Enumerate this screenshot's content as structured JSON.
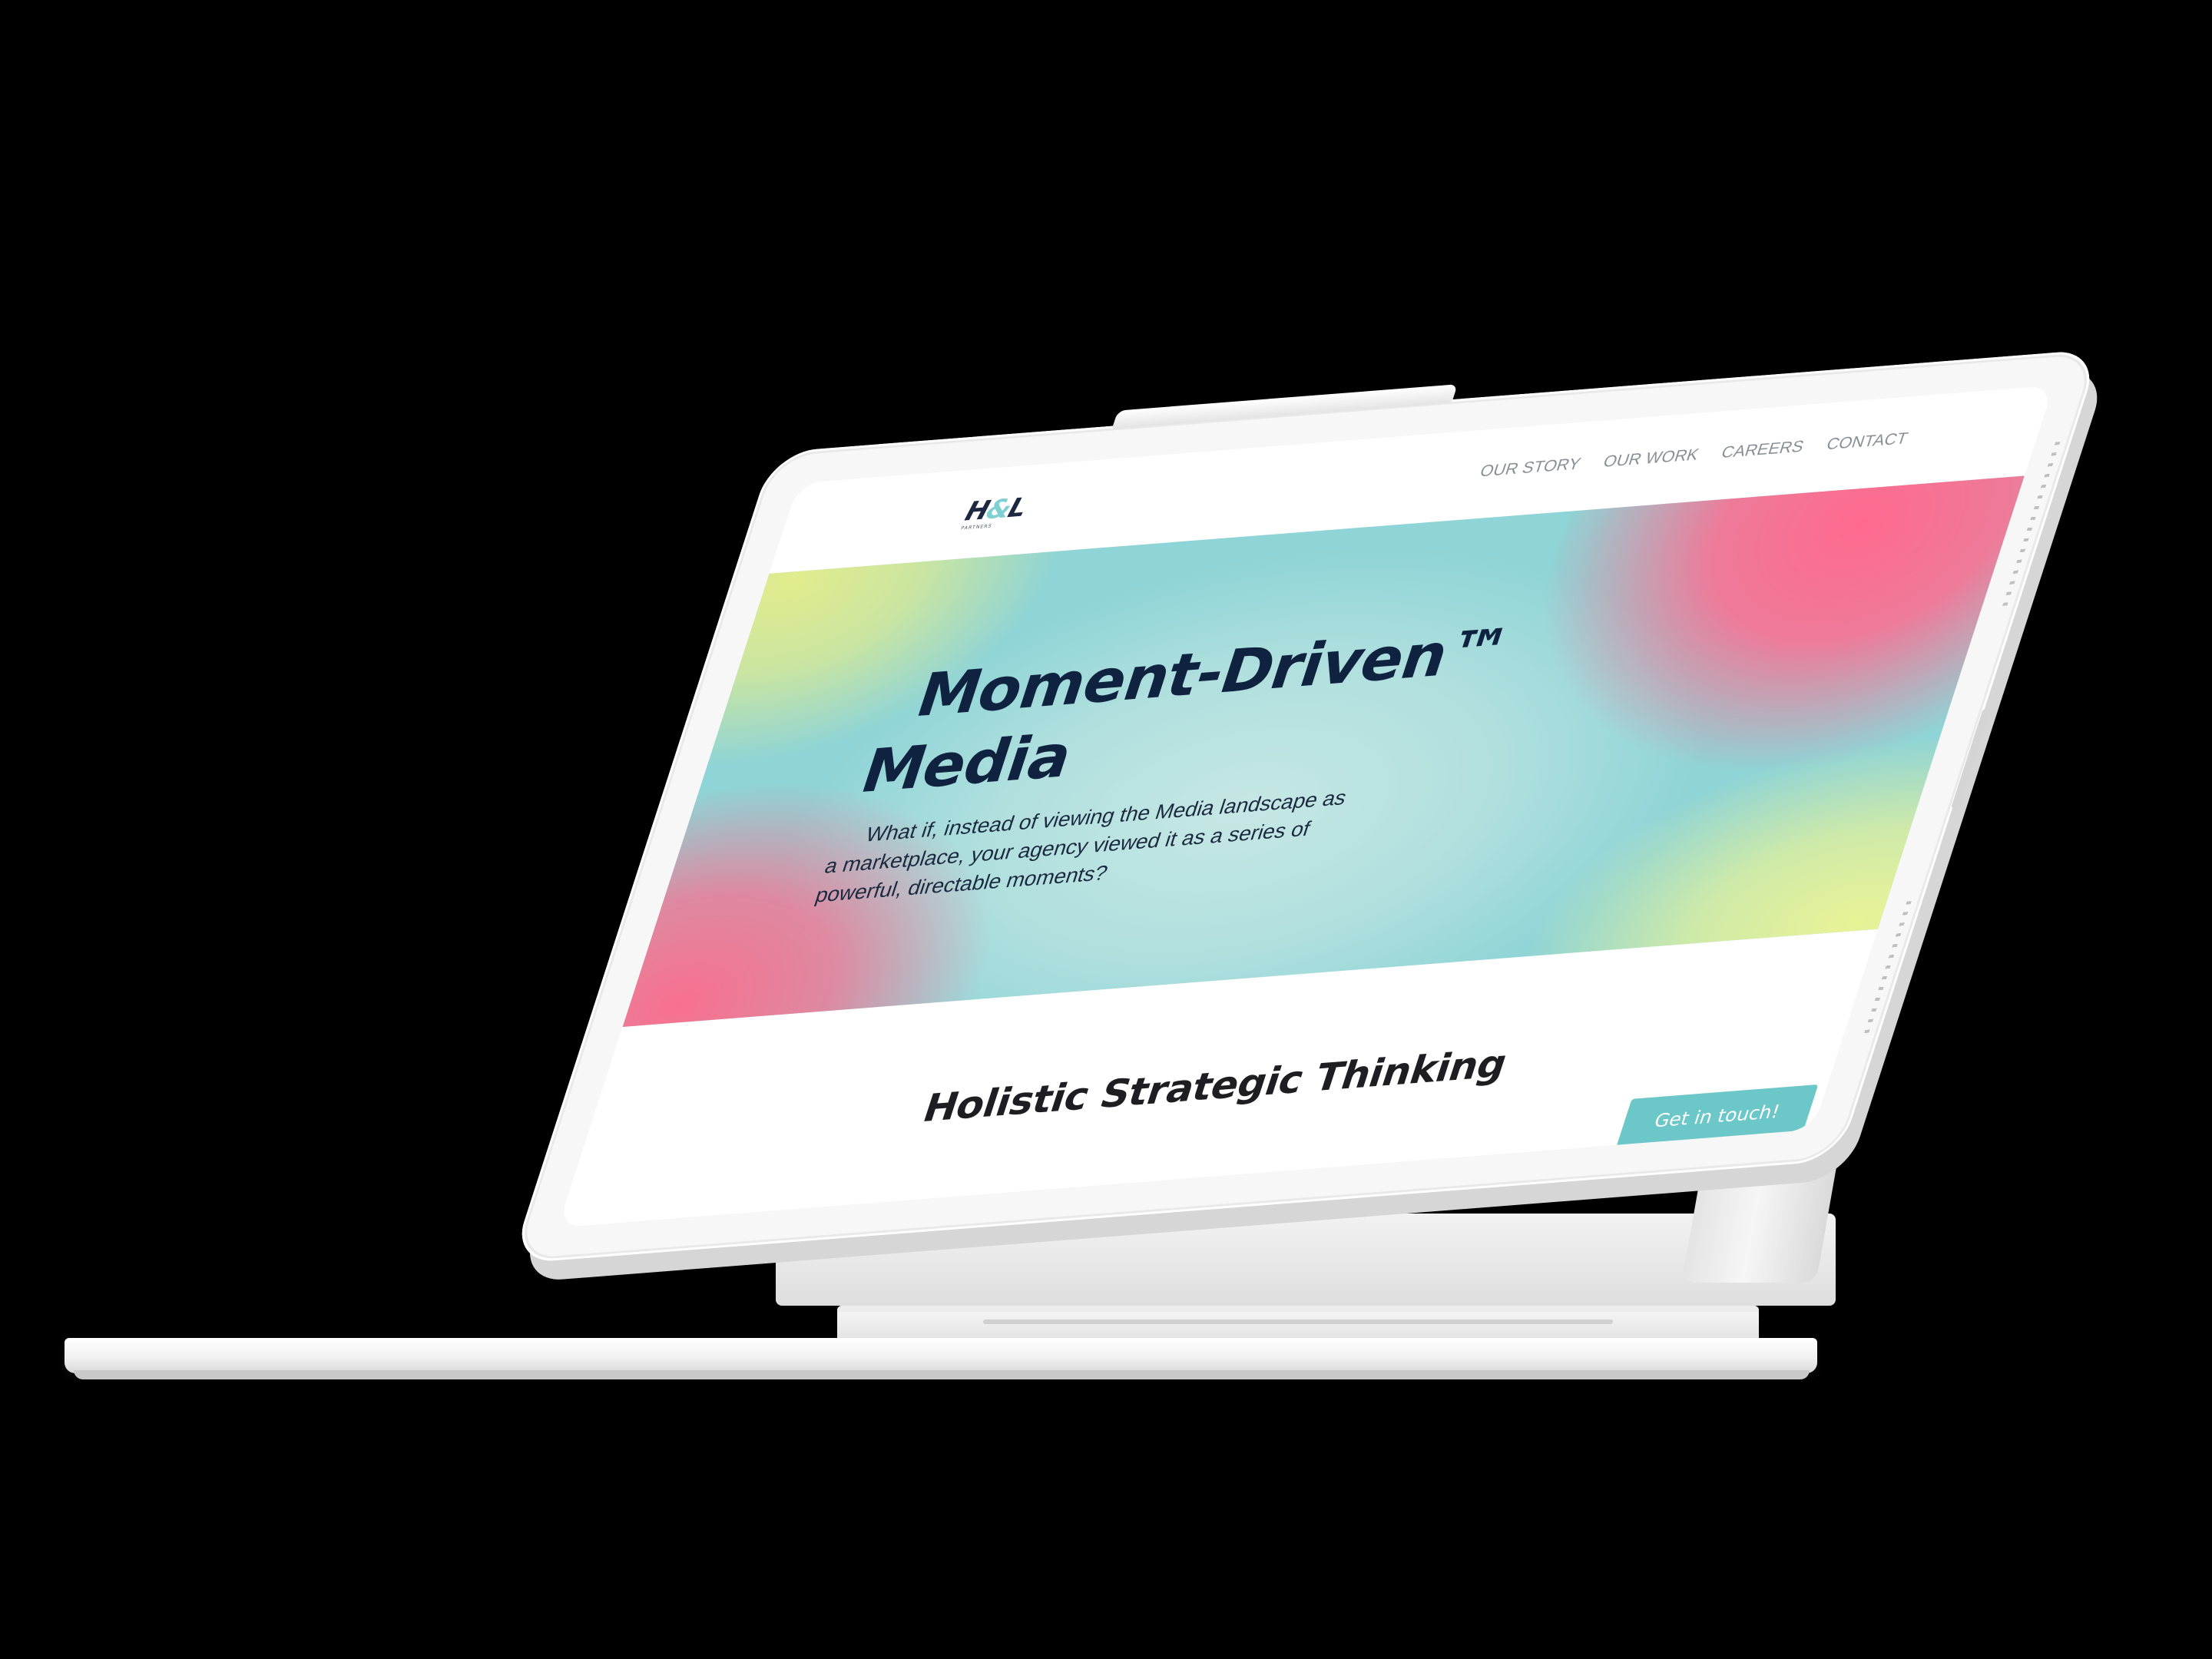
{
  "site": {
    "logo": {
      "mark_h": "H",
      "mark_amp": "&",
      "mark_l": "L",
      "subtitle": "PARTNERS"
    },
    "nav": {
      "items": [
        {
          "label": "OUR STORY"
        },
        {
          "label": "OUR WORK"
        },
        {
          "label": "CAREERS"
        },
        {
          "label": "CONTACT"
        }
      ]
    },
    "hero": {
      "title_line1": "Moment-Driven™",
      "title_line2": "Media",
      "subtitle": "What if, instead of viewing the Media landscape as a marketplace, your agency viewed it as a series of powerful, directable moments?"
    },
    "section": {
      "title": "Holistic Strategic Thinking"
    },
    "cta": {
      "label": "Get in touch!"
    }
  },
  "colors": {
    "background": "#000000",
    "accent": "#6cc7c9",
    "title_text": "#0f2340",
    "gradient_pink": "#ff6a8e",
    "gradient_teal": "#8fd4d6",
    "gradient_yellow": "#e2ec8c"
  }
}
